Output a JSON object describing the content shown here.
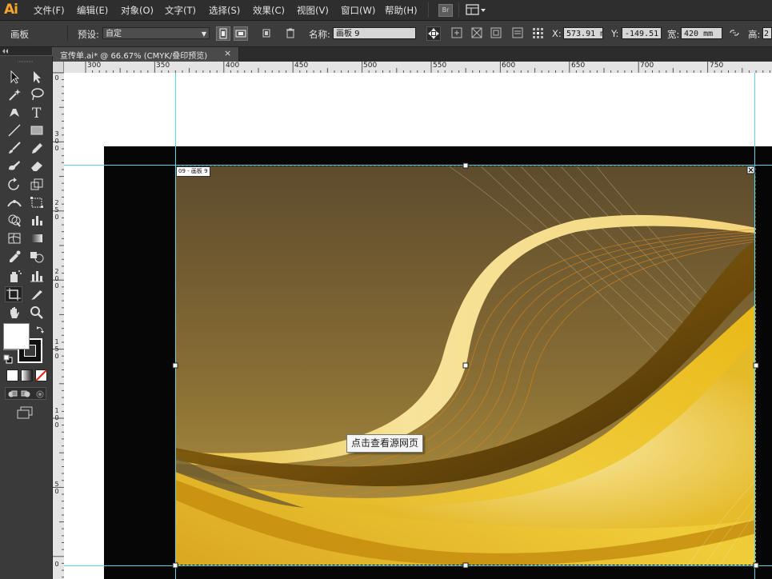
{
  "app": {
    "logo": "Ai",
    "accent_color": "#f7a52c"
  },
  "menu": [
    {
      "label": "文件(F)",
      "key": "file"
    },
    {
      "label": "编辑(E)",
      "key": "edit"
    },
    {
      "label": "对象(O)",
      "key": "object"
    },
    {
      "label": "文字(T)",
      "key": "type"
    },
    {
      "label": "选择(S)",
      "key": "select"
    },
    {
      "label": "效果(C)",
      "key": "effect"
    },
    {
      "label": "视图(V)",
      "key": "view"
    },
    {
      "label": "窗口(W)",
      "key": "window"
    },
    {
      "label": "帮助(H)",
      "key": "help"
    }
  ],
  "bridge_button": "Br",
  "control_bar": {
    "context_label": "画板",
    "preset_label": "预设:",
    "preset_value": "自定",
    "name_label": "名称:",
    "name_value": "画板 9",
    "x_label": "X:",
    "x_value": "573.91 m",
    "y_label": "Y:",
    "y_value": "-149.51",
    "width_label": "宽:",
    "width_value": "420 mm",
    "height_label": "高:",
    "height_value": "2"
  },
  "document_tab": {
    "title": "宣传单.ai* @ 66.67% (CMYK/叠印预览)",
    "close": "×"
  },
  "ruler_top_labels": [
    "300",
    "350",
    "400",
    "450",
    "500",
    "550",
    "600",
    "650",
    "700",
    "750"
  ],
  "ruler_left_labels": [
    "0",
    "300",
    "250",
    "200",
    "150",
    "100",
    "50",
    "0"
  ],
  "artboard_label": "09 - 画板 9",
  "tooltip": "点击查看源网页",
  "colors": {
    "ui_dark": "#2e2e2e",
    "ui_panel": "#3c3c3c",
    "guide": "#53d8e8",
    "artwork_bg_top": "#5f4d2e",
    "artwork_bg_bottom": "#a98a3a",
    "gold": "#e8b41a"
  }
}
